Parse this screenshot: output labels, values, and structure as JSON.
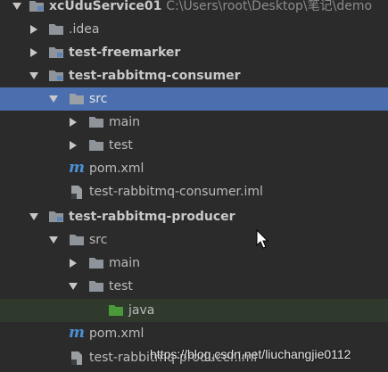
{
  "project": {
    "name": "xcUduService01",
    "path": "C:\\Users\\root\\Desktop\\笔记\\demo"
  },
  "tree": {
    "idea": ".idea",
    "freemarker": "test-freemarker",
    "consumer": {
      "name": "test-rabbitmq-consumer",
      "src": "src",
      "main": "main",
      "test": "test",
      "pom": "pom.xml",
      "iml": "test-rabbitmq-consumer.iml"
    },
    "producer": {
      "name": "test-rabbitmq-producer",
      "src": "src",
      "main": "main",
      "test": "test",
      "java": "java",
      "pom": "pom.xml",
      "iml": "test-rabbitmq-producer.iml"
    }
  },
  "watermark": "https://blog.csdn.net/liuchangjie0112",
  "colors": {
    "background": "#2b2b2b",
    "selection": "#4b6eaf",
    "highlight": "#2f3a2c",
    "folder": "#8e9499",
    "module_folder": "#8e9499",
    "source_folder": "#4a9a3a",
    "maven": "#4c8fd6"
  },
  "icons": {
    "expand": "triangle-right-icon",
    "collapse": "triangle-down-icon",
    "folder": "folder-icon",
    "module": "module-folder-icon",
    "maven": "maven-m-icon",
    "file": "iml-file-icon"
  }
}
